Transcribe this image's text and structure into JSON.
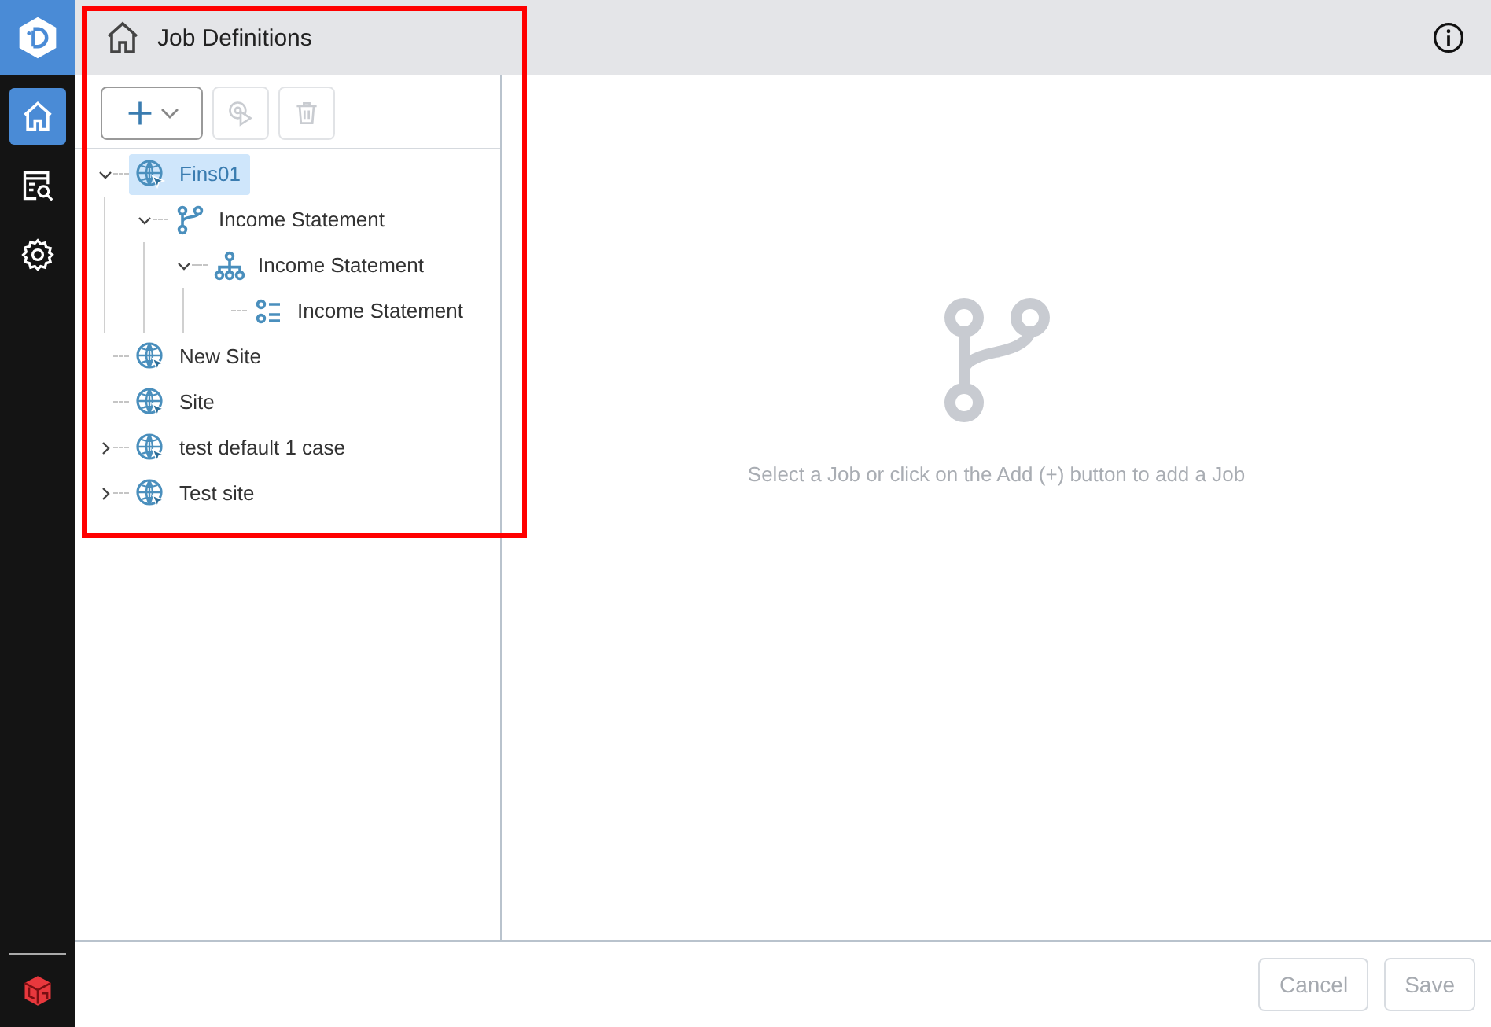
{
  "nav": [
    {
      "kind": "home",
      "selected": true
    },
    {
      "kind": "log_search",
      "selected": false
    },
    {
      "kind": "settings",
      "selected": false
    }
  ],
  "header": {
    "title": "Job Definitions"
  },
  "toolbar": [
    {
      "kind": "add",
      "disabled": false
    },
    {
      "kind": "run",
      "disabled": true
    },
    {
      "kind": "delete",
      "disabled": true
    }
  ],
  "tree": [
    {
      "kind": "site",
      "label": "Fins01",
      "selected": true,
      "expanded": true,
      "children": [
        {
          "kind": "job",
          "label": "Income Statement",
          "selected": false,
          "expanded": true,
          "children": [
            {
              "kind": "flow",
              "label": "Income Statement",
              "selected": false,
              "expanded": true,
              "children": [
                {
                  "kind": "task",
                  "label": "Income Statement",
                  "selected": false
                }
              ]
            }
          ]
        }
      ]
    },
    {
      "kind": "site",
      "label": "New Site",
      "selected": false
    },
    {
      "kind": "site",
      "label": "Site",
      "selected": false
    },
    {
      "kind": "site",
      "label": "test default 1 case",
      "selected": false,
      "expanded": false
    },
    {
      "kind": "site",
      "label": "Test site",
      "selected": false,
      "expanded": false
    }
  ],
  "empty_state": {
    "message": "Select a Job or click on the Add (+) button to add a Job"
  },
  "footer_buttons": [
    {
      "label": "Cancel",
      "disabled": true
    },
    {
      "label": "Save",
      "disabled": true
    }
  ],
  "highlight": {
    "visible": true
  }
}
